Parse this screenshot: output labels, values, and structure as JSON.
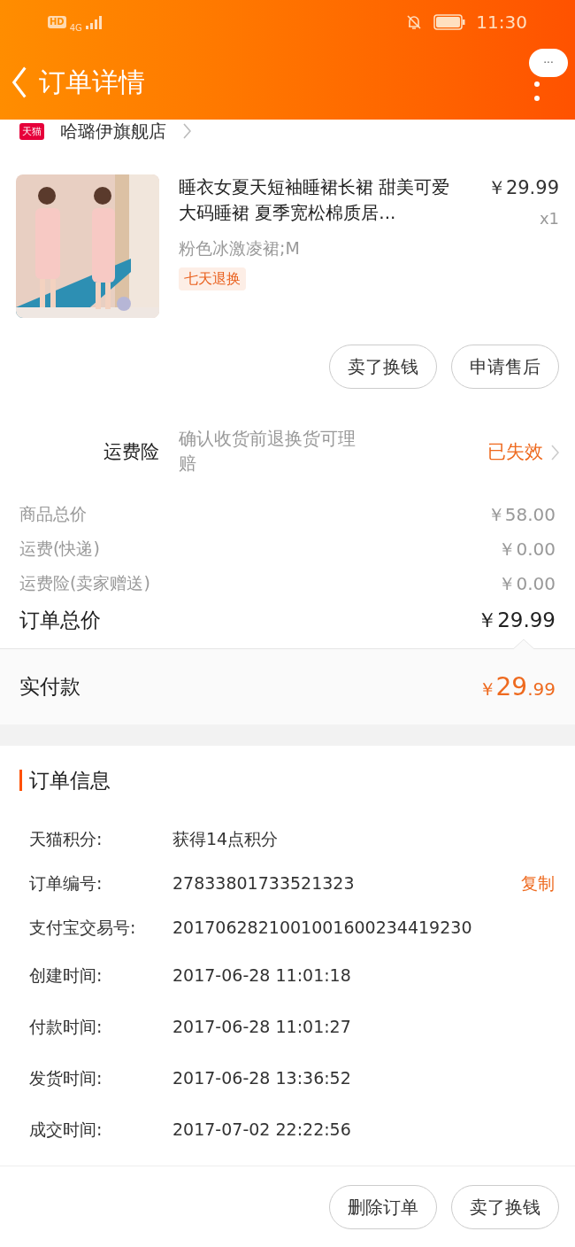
{
  "status_bar": {
    "hd": "HD",
    "network": "4G",
    "time": "11:30"
  },
  "header": {
    "title": "订单详情",
    "more": "···"
  },
  "store": {
    "badge": "天猫",
    "name": "哈璐伊旗舰店"
  },
  "product": {
    "kind": "picture",
    "title": "睡衣女夏天短袖睡裙长裙 甜美可爱大码睡裙 夏季宽松棉质居...",
    "price": "￥29.99",
    "quantity": "x1",
    "variant": "粉色冰激凌裙;M",
    "tag": "七天退换"
  },
  "product_actions": [
    "卖了换钱",
    "申请售后"
  ],
  "insurance": {
    "label": "运费险",
    "description": "确认收货前退换货可理赔",
    "status": "已失效"
  },
  "costs": [
    {
      "label": "商品总价",
      "value": "￥58.00"
    },
    {
      "label": "运费(快递)",
      "value": "￥0.00"
    },
    {
      "label": "运费险(卖家赠送)",
      "value": "￥0.00"
    }
  ],
  "total": {
    "label": "订单总价",
    "value": "￥29.99"
  },
  "paid": {
    "label": "实付款",
    "currency": "￥",
    "integer": "29",
    "decimal": ".99"
  },
  "order_info": {
    "title": "订单信息",
    "rows": [
      {
        "label": "天猫积分:",
        "value": "获得14点积分"
      },
      {
        "label": "订单编号:",
        "value": "27833801733521323",
        "action": "复制"
      },
      {
        "label": "支付宝交易号:",
        "value": "2017062821001001600234419230"
      },
      {
        "label": "创建时间:",
        "value": "2017-06-28 11:01:18"
      },
      {
        "label": "付款时间:",
        "value": "2017-06-28 11:01:27"
      },
      {
        "label": "发货时间:",
        "value": "2017-06-28 13:36:52"
      },
      {
        "label": "成交时间:",
        "value": "2017-07-02 22:22:56"
      }
    ]
  },
  "bottom_actions": [
    "删除订单",
    "卖了换钱"
  ]
}
